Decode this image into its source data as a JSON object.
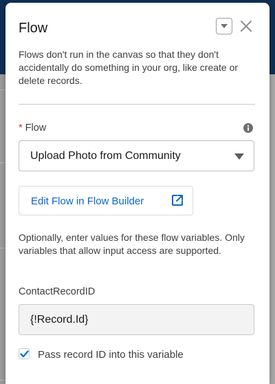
{
  "panel": {
    "title": "Flow",
    "description": "Flows don't run in the canvas so that they don't accidentally do something in your org, like create or delete records."
  },
  "flow_field": {
    "required_marker": "*",
    "label": "Flow",
    "selected_value": "Upload Photo from Community"
  },
  "edit_button": {
    "label": "Edit Flow in Flow Builder"
  },
  "help_text": "Optionally, enter values for these flow variables. Only variables that allow input access are supported.",
  "variable": {
    "label": "ContactRecordID",
    "value": "{!Record.Id}"
  },
  "pass_record": {
    "checked": true,
    "label": "Pass record ID into this variable"
  },
  "colors": {
    "link": "#0b66c4",
    "required": "#c23934",
    "checkbox_check": "#0176d3"
  },
  "icons": {
    "menu": "chevron-down-icon",
    "close": "close-icon",
    "info": "info-icon",
    "external": "new-window-icon",
    "check": "checkmark-icon"
  }
}
